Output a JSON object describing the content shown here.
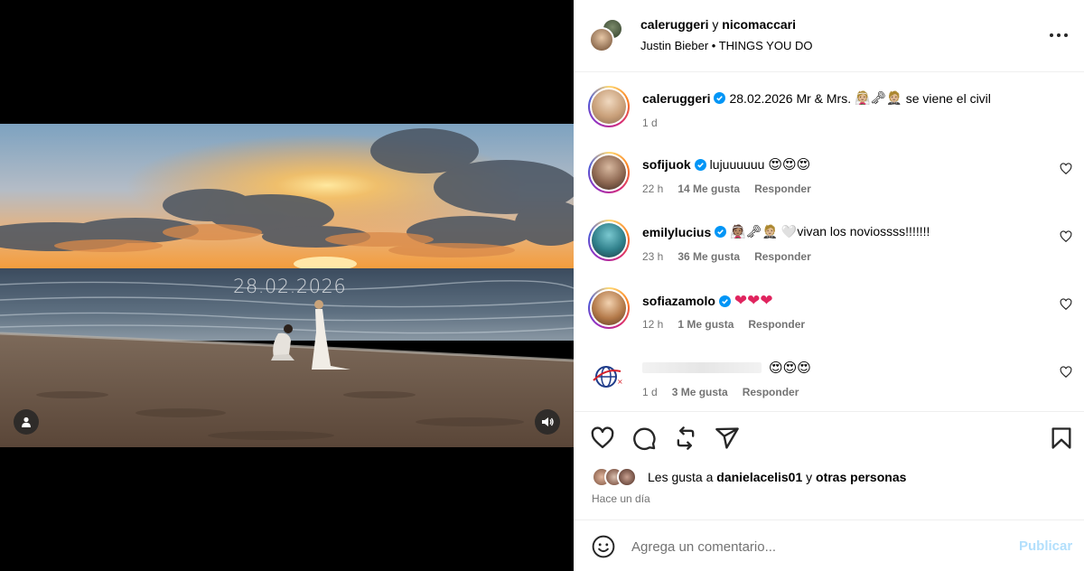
{
  "video": {
    "overlay_date": "28.02.2026",
    "user_icon": "user-icon",
    "sound_icon": "speaker-icon"
  },
  "header": {
    "user1": "caleruggeri",
    "connector": "y",
    "user2": "nicomaccari",
    "music": "Justin Bieber • THINGS YOU DO",
    "more_icon": "more-horizontal-icon"
  },
  "caption": {
    "user": "caleruggeri",
    "text_before": "28.02.2026 Mr & Mrs.",
    "text_after": "se viene el civil",
    "time": "1 d"
  },
  "comments": [
    {
      "user": "sofijuok",
      "text": "lujuuuuuu",
      "emojis": "😍😍😍",
      "time": "22 h",
      "likes": "14 Me gusta",
      "reply": "Responder",
      "verified": true
    },
    {
      "user": "emilylucius",
      "text": "🤍vivan los noviossss!!!!!!!",
      "emojis": "",
      "time": "23 h",
      "likes": "36 Me gusta",
      "reply": "Responder",
      "verified": true
    },
    {
      "user": "sofiazamolo",
      "text": "",
      "emojis": "❤❤❤",
      "time": "12 h",
      "likes": "1 Me gusta",
      "reply": "Responder",
      "verified": true
    },
    {
      "user": "",
      "text": "",
      "emojis": "😍😍😍",
      "time": "1 d",
      "likes": "3 Me gusta",
      "reply": "Responder",
      "verified": false
    }
  ],
  "likes": {
    "prefix": "Les gusta a",
    "user": "danielacelis01",
    "connector": "y",
    "others": "otras personas"
  },
  "timestamp": "Hace un día",
  "composer": {
    "placeholder": "Agrega un comentario...",
    "publish": "Publicar"
  },
  "colors": {
    "verified": "#0095f6",
    "publish_disabled": "#b2dffc",
    "secondary_text": "#737373",
    "heart_red": "#e0245e"
  }
}
